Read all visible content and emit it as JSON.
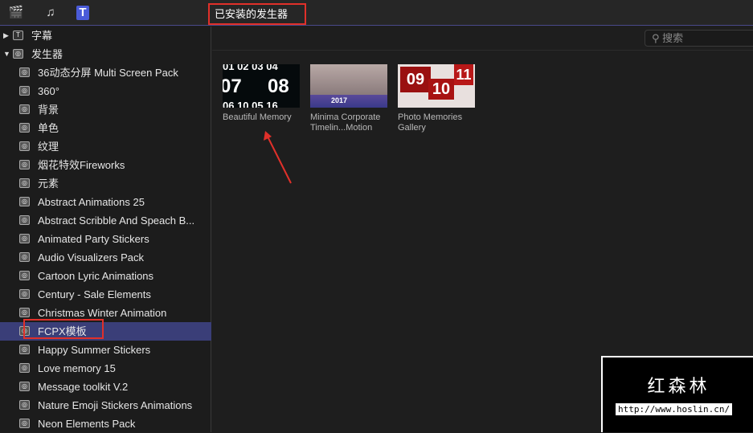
{
  "toolbar": {
    "icons": [
      "clapper-star-icon",
      "music-icon",
      "titles-icon"
    ],
    "selector": "已安装的发生器 ⌃⌄"
  },
  "sidebar": {
    "top": [
      {
        "label": "字幕",
        "expanded": false
      },
      {
        "label": "发生器",
        "expanded": true
      }
    ],
    "items": [
      "36动态分屏 Multi Screen Pack",
      "360°",
      "背景",
      "单色",
      "纹理",
      "烟花特效Fireworks",
      "元素",
      "Abstract Animations 25",
      "Abstract Scribble And Speach B...",
      "Animated Party Stickers",
      "Audio Visualizers Pack",
      "Cartoon Lyric Animations",
      "Century - Sale Elements",
      "Christmas Winter Animation",
      "FCPX模板",
      "Happy Summer Stickers",
      "Love memory 15",
      "Message toolkit V.2",
      "Nature Emoji Stickers Animations",
      "Neon Elements Pack"
    ],
    "selected_index": 14
  },
  "search": {
    "placeholder": "搜索"
  },
  "thumbnails": [
    {
      "line1": "Beautiful Memory",
      "line2": ""
    },
    {
      "line1": "Minima Corporate",
      "line2": "Timelin...Motion"
    },
    {
      "line1": "Photo Memories",
      "line2": "Gallery"
    }
  ],
  "thumb_text": {
    "t1a": "01 02 03 04",
    "t1b": "07",
    "t1c": "08",
    "t1d": "06 10 05 16",
    "t2": "2017",
    "t3a": "09",
    "t3b": "10",
    "t3c": "11"
  },
  "watermark": {
    "title": "红森林",
    "url": "http://www.hoslin.cn/"
  },
  "colors": {
    "accent": "#3a3e78",
    "highlight": "#e0302a"
  }
}
